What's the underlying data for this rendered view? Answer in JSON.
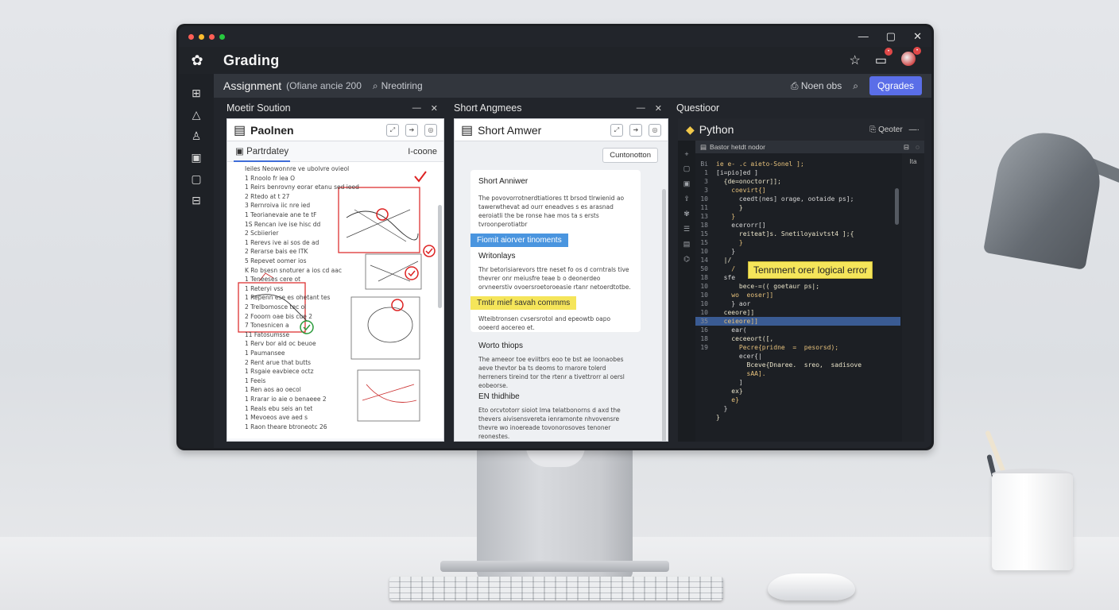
{
  "window": {
    "traffic_colors": [
      "#ff5f56",
      "#ffbd2e",
      "#ff5f56",
      "#27c93f"
    ],
    "controls": [
      "—",
      "▢",
      "✕"
    ]
  },
  "app": {
    "title": "Grading",
    "logo_icon": "paw-icon"
  },
  "toolbar": {
    "assignment_label": "Assignment",
    "assignment_meta": "(Ofiane ancie 200",
    "search_text": "Nreotiring",
    "right_item": "Noen obs",
    "grades_button": "Qgrades"
  },
  "panes": {
    "left": {
      "header": "Moetir Soution",
      "card_title": "Paolnen",
      "tab_active": "Partrdatey",
      "tab_right": "I-coone",
      "worksheet_lines": [
        "Ieiles              Neowonnre ve ubolvre ovieol",
        "1  Rnoolo fr iea O",
        "1  Reirs benrovny eorar etanu sed ieed",
        "2  Rtedo at t 27",
        "3  Rernroiva iic nre ied",
        "1  Teorianevaie ane te tF",
        "1S  Rencan ive ise hisc dd",
        "2  Scbiierier",
        "1  Rerevs ive ai sos de ad",
        "2  Rerarse bais ee ITK",
        "5  Repevet oomer ios",
        "K  Ro bsesn snoturer a ios cd aac",
        "1  Teneeses cere ot",
        "1  Reteryi vss",
        "1  Repenn ese es ohetant tes",
        "2  Trelbomosce tec ol",
        "2  Fooorn oae bis cue 2",
        "7  Tonesnicen a",
        "11  Fatosumsse",
        "1  Rerv bor ald oc beuoe",
        "1  Paumansee",
        "2  Rent arue that butts",
        "1  Rsgaie eavbiece octz",
        "1  Feeis",
        "1  Ren aos ao oecol",
        "1  Rrarar io aie o benaeee 2",
        "1  Reals ebu seis an tet",
        "1  Mevoeos ave aed s",
        "1  Raon theare btroneotc 26"
      ]
    },
    "middle": {
      "header": "Short Angmees",
      "card_title": "Short Amwer",
      "continue_button": "Cuntonotton",
      "question_title": "Short Anniwer",
      "question_text": "The povovorrotnerdtiatiores tt brsod tlrwienid ao tawerwthevat ad ourr eneadves s es arasnad eeroiatli the be ronse hae mos ta s ersts tvroonperotiatbr",
      "highlight_blue": "Fiomit aiorver tinoments",
      "section_title_1": "Writonlays",
      "section_text_1": "Thr betorisiarevors ttre neset fo os d corntrals tive thevrer onr meiusfre teae b o deonerdeo orvneerstiv ovoersroetoroeasie rtanr netoerdtotbe.",
      "highlight_yellow": "Tmtir mief savah commms",
      "section_text_2": "Wteibtronsen cvsersrotol and epeowtb oapo ooeerd aocereo et.",
      "section_title_2": "Worto thiops",
      "section_text_3": "The ameeor toe eviitbrs eoo te bst ae loonaobes aeve thevtor ba ts deoms to rnarore tolerd herreners tireind tor the rtenr a tivettrorr al oersl eobeorse.",
      "section_title_3": "EN thidhibe",
      "section_text_4": "Eto orcvtotorr sioiot Ima telatbonorns d axd the thevers aivisensvereta ienramonte nhvovensre thevre wo inoereade tovonorosoves tenoner reonestes."
    },
    "right": {
      "header": "Questioor",
      "card_title": "Python",
      "head_right": "Qeoter",
      "inner_header": "Bastor hetdt nodor",
      "tooltip": "Tennment orer logical error",
      "right_col_label": "Ita",
      "code_lines": [
        {
          "n": "Bi",
          "t": "ie e- .c aieto-Sonel ];"
        },
        {
          "n": "1",
          "t": "[i=pio]ed ]"
        },
        {
          "n": "3",
          "t": "  {de=onoctorr]];"
        },
        {
          "n": "3",
          "t": "    coevirt{]"
        },
        {
          "n": "10",
          "t": "      ceedt(nes] orage, ootaide ps];"
        },
        {
          "n": "11",
          "t": "      }"
        },
        {
          "n": "13",
          "t": "    }"
        },
        {
          "n": "18",
          "t": "    ecerorr[]"
        },
        {
          "n": "15",
          "t": "      reiteat]s. Snetiloyaivtst4 ];{"
        },
        {
          "n": "15",
          "t": "      }"
        },
        {
          "n": "10",
          "t": "    }"
        },
        {
          "n": "14",
          "t": "  |/"
        },
        {
          "n": "50",
          "t": "    /"
        },
        {
          "n": "18",
          "t": "  sfe"
        },
        {
          "n": "10",
          "t": "      bece-=(( goetaur ps|;"
        },
        {
          "n": "10",
          "t": "    wo  eoser]]"
        },
        {
          "n": "10",
          "t": "    } aor"
        },
        {
          "n": "10",
          "t": "  ceeore]]"
        },
        {
          "n": "35",
          "t": "  ceieore]]"
        },
        {
          "n": "16",
          "t": "    ear("
        },
        {
          "n": "18",
          "t": "    ceceeort([,"
        },
        {
          "n": "19",
          "t": "      Pecre{pridne  =  pesorsd);"
        },
        {
          "n": "",
          "t": "      ecer{|"
        },
        {
          "n": "",
          "t": "        Bceve{Dnaree.  sreo,  sadisove"
        },
        {
          "n": "",
          "t": "        sAA]."
        },
        {
          "n": "",
          "t": "      ]"
        },
        {
          "n": "",
          "t": "    ex}"
        },
        {
          "n": "",
          "t": "    e}"
        },
        {
          "n": "",
          "t": "  }"
        },
        {
          "n": "",
          "t": "}"
        }
      ],
      "highlight_line_index": 18
    }
  }
}
